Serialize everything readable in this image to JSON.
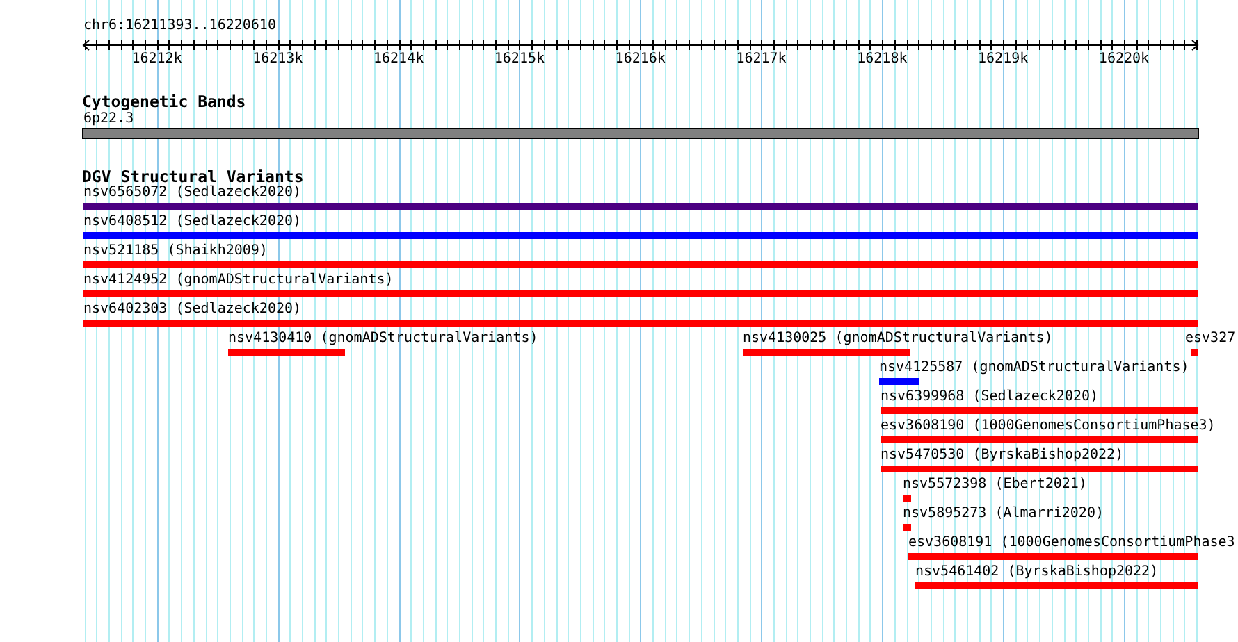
{
  "ruler": {
    "location": "chr6:16211393..16220610",
    "ticks": [
      "16212k",
      "16213k",
      "16214k",
      "16215k",
      "16216k",
      "16217k",
      "16218k",
      "16219k",
      "16220k"
    ]
  },
  "tracks": [
    {
      "title": "Cytogenetic Bands",
      "kind": "bands",
      "bands": [
        {
          "label": "6p22.3"
        }
      ]
    },
    {
      "title": "DGV Structural Variants",
      "kind": "features",
      "lanes": [
        {
          "features": [
            {
              "label": "nsv6565072 (Sedlazeck2020)",
              "color": "#4b0082"
            }
          ]
        },
        {
          "features": [
            {
              "label": "nsv6408512 (Sedlazeck2020)",
              "color": "#0000ff"
            }
          ]
        },
        {
          "features": [
            {
              "label": "nsv521185 (Shaikh2009)",
              "color": "#ff0000"
            }
          ]
        },
        {
          "features": [
            {
              "label": "nsv4124952 (gnomADStructuralVariants)",
              "color": "#ff0000"
            }
          ]
        },
        {
          "features": [
            {
              "label": "nsv6402303 (Sedlazeck2020)",
              "color": "#ff0000"
            }
          ]
        },
        {
          "features": [
            {
              "label": "nsv4130410 (gnomADStructuralVariants)",
              "color": "#ff0000"
            },
            {
              "label": "nsv4130025 (gnomADStructuralVariants)",
              "color": "#ff0000"
            },
            {
              "label": "esv327",
              "color": "#ff0000"
            }
          ]
        },
        {
          "features": [
            {
              "label": "nsv4125587 (gnomADStructuralVariants)",
              "color": "#0000ff"
            }
          ]
        },
        {
          "features": [
            {
              "label": "nsv6399968 (Sedlazeck2020)",
              "color": "#ff0000"
            }
          ]
        },
        {
          "features": [
            {
              "label": "esv3608190 (1000GenomesConsortiumPhase3)",
              "color": "#ff0000"
            }
          ]
        },
        {
          "features": [
            {
              "label": "nsv5470530 (ByrskaBishop2022)",
              "color": "#ff0000"
            }
          ]
        },
        {
          "features": [
            {
              "label": "nsv5572398 (Ebert2021)",
              "color": "#ff0000"
            }
          ]
        },
        {
          "features": [
            {
              "label": "nsv5895273 (Almarri2020)",
              "color": "#ff0000"
            }
          ]
        },
        {
          "features": [
            {
              "label": "esv3608191 (1000GenomesConsortiumPhase3",
              "color": "#ff0000"
            }
          ]
        },
        {
          "features": [
            {
              "label": "nsv5461402 (ByrskaBishop2022)",
              "color": "#ff0000"
            }
          ]
        }
      ]
    }
  ]
}
